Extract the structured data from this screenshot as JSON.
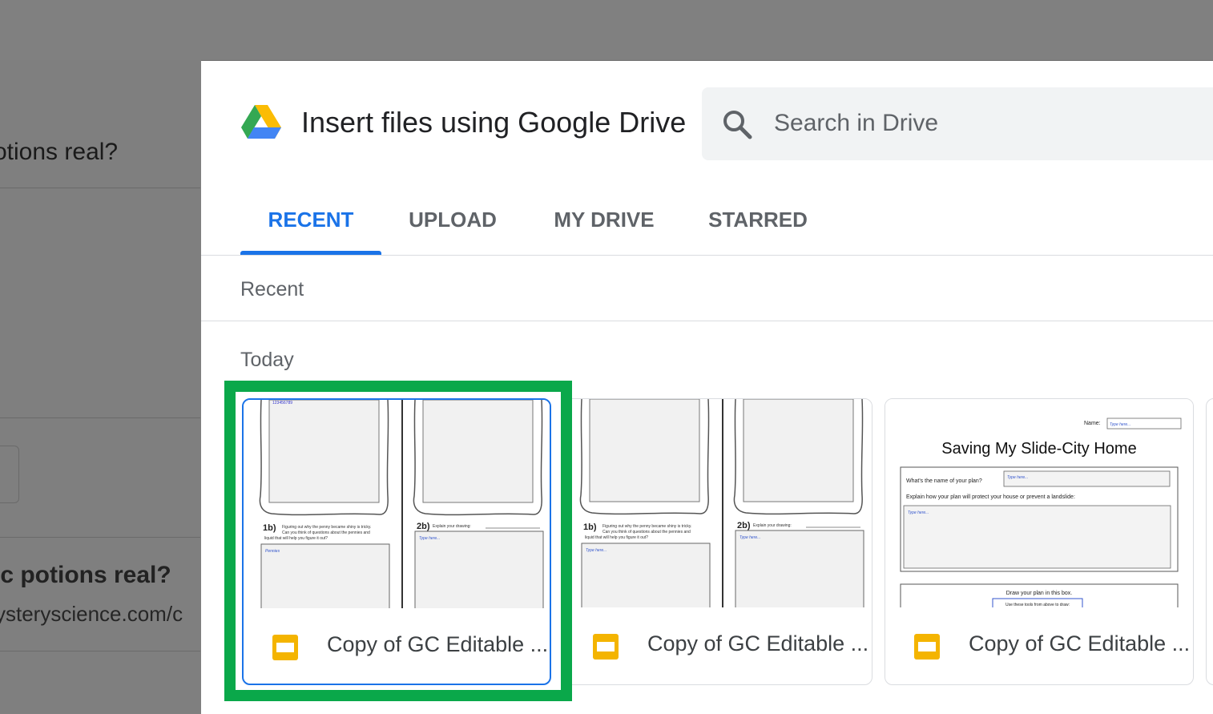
{
  "background": {
    "question_1": "otions real?",
    "question_2": "ic potions real?",
    "url": "ysteryscience.com/c"
  },
  "dialog": {
    "title": "Insert files using Google Drive",
    "search_placeholder": "Search in Drive",
    "tabs": [
      {
        "label": "RECENT",
        "active": true
      },
      {
        "label": "UPLOAD",
        "active": false
      },
      {
        "label": "MY DRIVE",
        "active": false
      },
      {
        "label": "STARRED",
        "active": false
      }
    ],
    "section_title": "Recent",
    "group_title": "Today",
    "files": [
      {
        "name": "Copy of GC Editable ...",
        "type": "slides",
        "selected": true
      },
      {
        "name": "Copy of GC Editable ...",
        "type": "slides",
        "selected": false
      },
      {
        "name": "Copy of GC Editable ...",
        "type": "slides",
        "selected": false
      }
    ],
    "thumb_a": {
      "id_text": "123456789",
      "q1_num": "1b)",
      "q1_text_1": "Figuring out why the penny became shiny is tricky.",
      "q1_text_2": "Can you think of questions about the pennies and",
      "q1_text_3": "liquid that will help you figure it out?",
      "q2_num": "2b)",
      "q2_text": "Explain your drawing:",
      "box1_text": "Pennies",
      "box2_text": "Type here..."
    },
    "thumb_b": {
      "q1_num": "1b)",
      "q1_text_1": "Figuring out why the penny became shiny is tricky.",
      "q1_text_2": "Can you think of questions about the pennies and",
      "q1_text_3": "liquid that will help you figure it out?",
      "q2_num": "2b)",
      "q2_text": "Explain your drawing:",
      "box1_text": "Type here...",
      "box2_text": "Type here..."
    },
    "thumb_c": {
      "name_label": "Name:",
      "name_value": "Type here...",
      "heading": "Saving My Slide-City Home",
      "q_plan_name": "What's the name of your plan?",
      "q_plan_value": "Type here...",
      "q_explain": "Explain how your plan will protect your house or prevent a landslide:",
      "explain_value": "Type here...",
      "draw_label": "Draw your plan in this box.",
      "draw_hint": "Use these tools from above to draw:"
    }
  },
  "colors": {
    "accent": "#1a73e8",
    "highlight": "#0aa84a",
    "slides": "#f4b400"
  }
}
